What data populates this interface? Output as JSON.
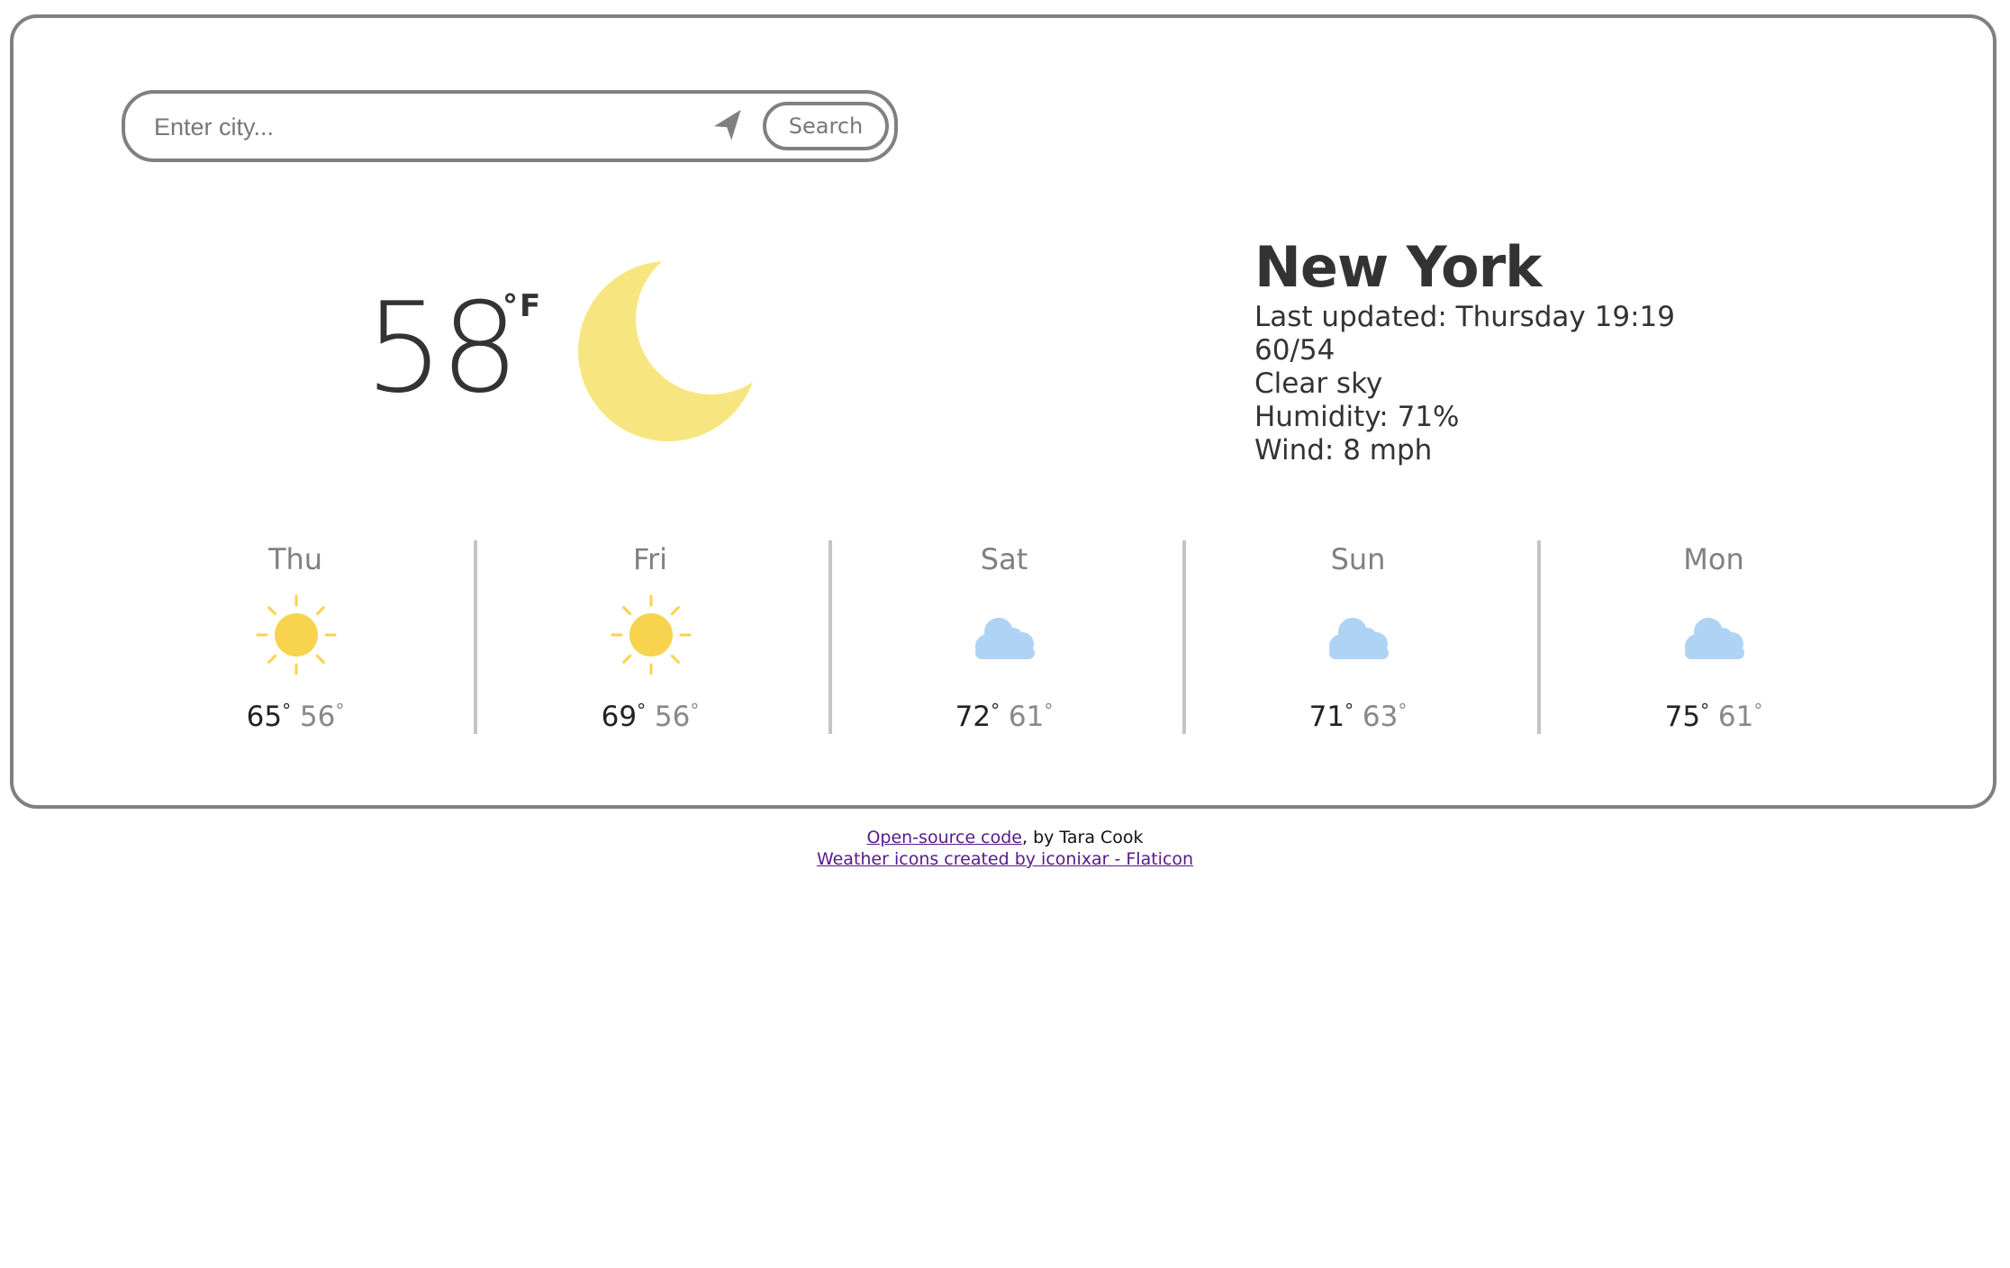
{
  "search": {
    "placeholder": "Enter city...",
    "value": "",
    "location_icon": "navigation-arrow-icon",
    "button_label": "Search"
  },
  "current": {
    "temperature": "58",
    "unit": "°F",
    "icon": "crescent-moon-icon",
    "city": "New York",
    "last_updated": "Last updated: Thursday 19:19",
    "high_low": "60/54",
    "description": "Clear sky",
    "humidity": "Humidity: 71%",
    "wind": "Wind: 8 mph"
  },
  "forecast": [
    {
      "day": "Thu",
      "icon": "sun-icon",
      "high": "65",
      "low": "56"
    },
    {
      "day": "Fri",
      "icon": "sun-icon",
      "high": "69",
      "low": "56"
    },
    {
      "day": "Sat",
      "icon": "cloud-icon",
      "high": "72",
      "low": "61"
    },
    {
      "day": "Sun",
      "icon": "cloud-icon",
      "high": "71",
      "low": "63"
    },
    {
      "day": "Mon",
      "icon": "cloud-icon",
      "high": "75",
      "low": "61"
    }
  ],
  "degree_symbol": "°",
  "footer": {
    "source_link": "Open-source code",
    "author_text": ", by Tara Cook",
    "icons_link": "Weather icons created by iconixar - Flaticon"
  },
  "colors": {
    "border": "#808080",
    "moon": "#F7E67F",
    "sun": "#F7D34E",
    "cloud": "#AED3F4",
    "link": "#551A8B"
  }
}
